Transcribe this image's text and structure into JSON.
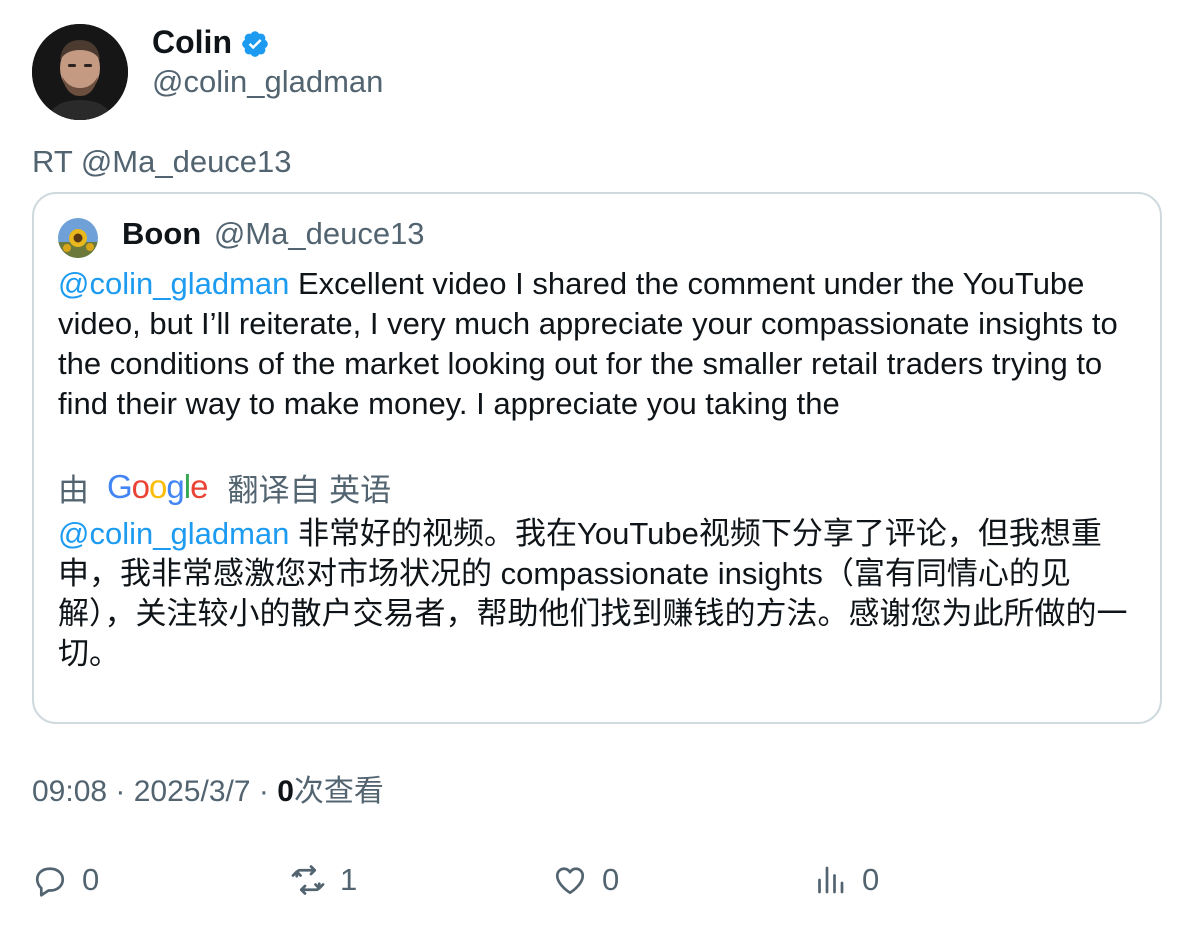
{
  "tweet": {
    "author_name": "Colin",
    "author_handle": "@colin_gladman",
    "retweet_label": "RT @Ma_deuce13"
  },
  "quote": {
    "author_name": "Boon",
    "author_handle": "@Ma_deuce13",
    "mention": "@colin_gladman",
    "text": " Excellent video I shared the comment under the YouTube video, but I’ll reiterate, I very much appreciate your compassionate insights to the conditions of the market looking out for the smaller retail traders trying to find their way to make money. I appreciate you taking the",
    "translate_prefix": "由",
    "translate_brand": "Google",
    "translate_suffix": "翻译自 英语",
    "translated_mention": "@colin_gladman",
    "translated_text": " 非常好的视频。我在YouTube视频下分享了评论，但我想重申，我非常感激您对市场状况的 compassionate insights（富有同情心的见解），关注较小的散户交易者，帮助他们找到赚钱的方法。感谢您为此所做的一切。"
  },
  "meta": {
    "time": "09:08",
    "separator": " · ",
    "date": "2025/3/7",
    "views_count": "0",
    "views_label": "次查看"
  },
  "actions": {
    "reply_count": "0",
    "retweet_count": "1",
    "like_count": "0",
    "views_count": "0"
  },
  "colors": {
    "accent": "#1d9bf0",
    "secondary_text": "#536471",
    "border": "#cfd9de"
  }
}
